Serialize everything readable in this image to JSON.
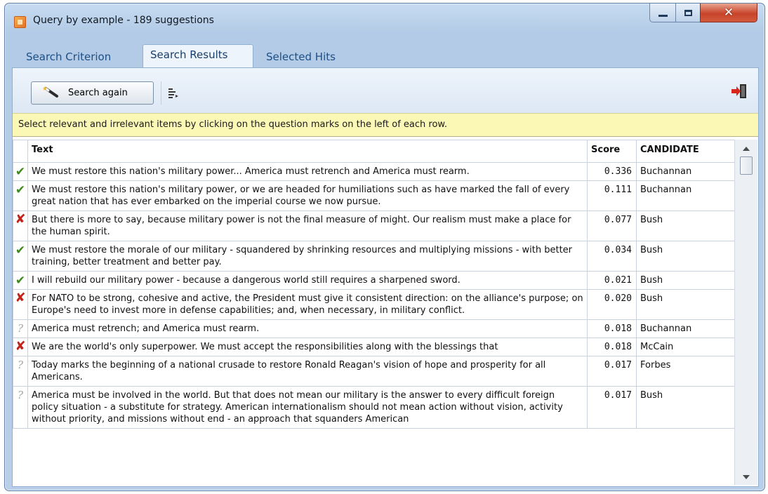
{
  "window": {
    "title": "Query by example - 189 suggestions"
  },
  "window_controls": {
    "minimize": "minimize",
    "maximize": "maximize",
    "close": "close"
  },
  "tabs": [
    "Search Criterion",
    "Search Results",
    "Selected Hits"
  ],
  "active_tab": "Search Results",
  "toolbar": {
    "search_again_label": "Search again"
  },
  "hint": "Select relevant and irrelevant items by clicking on the question marks on the left of each row.",
  "table": {
    "columns": [
      "Text",
      "Score",
      "CANDIDATE"
    ],
    "rows": [
      {
        "status": "relevant",
        "text": "We must restore this nation's military power... America must retrench and America must rearm.",
        "score": "0.336",
        "candidate": "Buchannan"
      },
      {
        "status": "relevant",
        "text": "We must restore this nation's military power, or we are headed for humiliations such as have marked the fall of every great nation that has ever embarked on the imperial course we now pursue.",
        "score": "0.111",
        "candidate": "Buchannan"
      },
      {
        "status": "irrelevant",
        "text": "But there is more to say, because military power is not the final measure of might. Our realism must make a place for the human spirit.",
        "score": "0.077",
        "candidate": "Bush"
      },
      {
        "status": "relevant",
        "text": "We must restore the morale of our military - squandered by shrinking resources and multiplying missions - with better training, better treatment and better pay.",
        "score": "0.034",
        "candidate": "Bush"
      },
      {
        "status": "relevant",
        "text": "I will rebuild our military power - because a dangerous world still requires a sharpened sword.",
        "score": "0.021",
        "candidate": "Bush"
      },
      {
        "status": "irrelevant",
        "text": "For NATO to be strong, cohesive and active, the President must give it consistent direction: on the alliance's purpose; on Europe's need to invest more in defense capabilities; and, when necessary, in military conflict.",
        "score": "0.020",
        "candidate": "Bush"
      },
      {
        "status": "unknown",
        "text": "America must retrench; and America must rearm.",
        "score": "0.018",
        "candidate": "Buchannan"
      },
      {
        "status": "irrelevant",
        "text": "We are the world's only superpower. We must accept the responsibilities along with the blessings that",
        "score": "0.018",
        "candidate": "McCain"
      },
      {
        "status": "unknown",
        "text": "Today marks the beginning of a national crusade to restore Ronald Reagan's vision of hope and prosperity for all Americans.",
        "score": "0.017",
        "candidate": "Forbes"
      },
      {
        "status": "unknown",
        "text": "America must be involved in the world. But that does not mean our military is the answer to every difficult foreign policy situation - a substitute for strategy. American internationalism should not mean action without vision, activity without priority, and missions without end - an approach that squanders American",
        "score": "0.017",
        "candidate": "Bush"
      }
    ]
  },
  "status_icons": {
    "relevant": "check-icon",
    "irrelevant": "cross-icon",
    "unknown": "question-icon"
  },
  "colors": {
    "relevant": "#3d8a1c",
    "irrelevant": "#c0231a",
    "unknown": "#a6a6a6",
    "hint_bg": "#fbf7b5",
    "tab_text": "#1d4f86"
  }
}
